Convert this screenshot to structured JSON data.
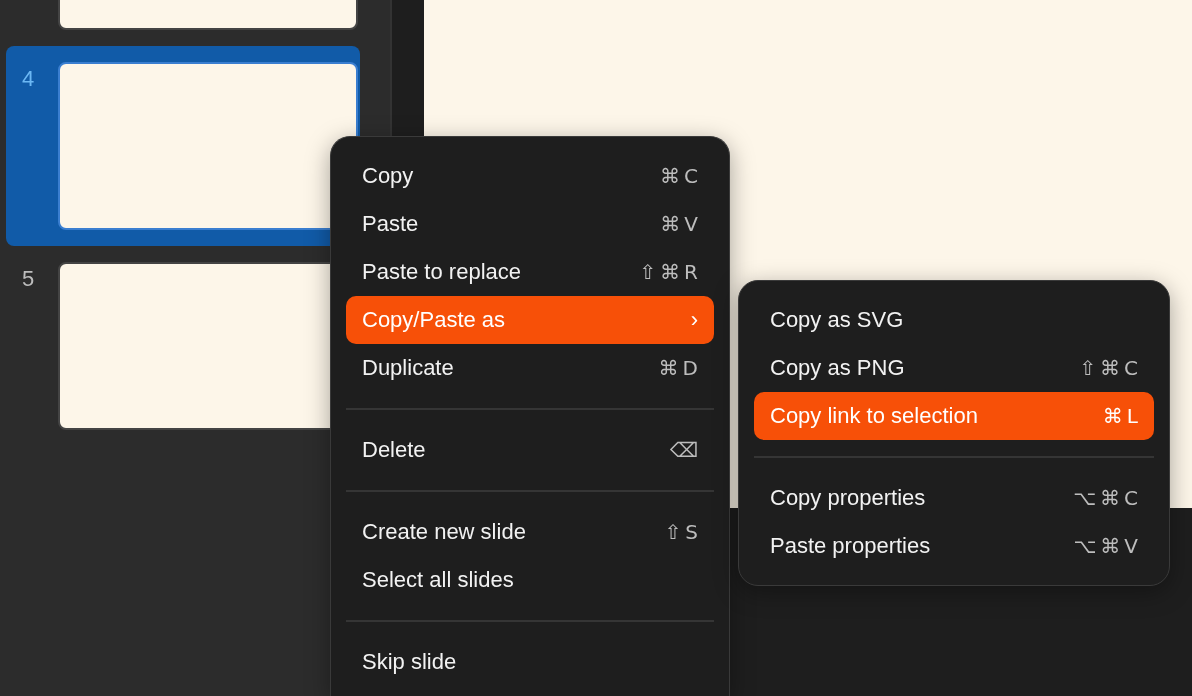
{
  "slides": [
    {
      "selected": false
    },
    {
      "number": "4",
      "selected": true
    },
    {
      "number": "5",
      "selected": false
    }
  ],
  "context_menu": {
    "items": [
      {
        "kind": "item",
        "label": "Copy",
        "shortcut": "⌘C",
        "selected": false
      },
      {
        "kind": "item",
        "label": "Paste",
        "shortcut": "⌘V",
        "selected": false
      },
      {
        "kind": "item",
        "label": "Paste to replace",
        "shortcut": "⇧⌘R",
        "selected": false
      },
      {
        "kind": "submenu",
        "label": "Copy/Paste as",
        "arrow": "›",
        "selected": true
      },
      {
        "kind": "item",
        "label": "Duplicate",
        "shortcut": "⌘D",
        "selected": false
      },
      {
        "kind": "separator"
      },
      {
        "kind": "item",
        "label": "Delete",
        "shortcut": "⌫",
        "selected": false
      },
      {
        "kind": "separator"
      },
      {
        "kind": "item",
        "label": "Create new slide",
        "shortcut": "⇧S",
        "selected": false
      },
      {
        "kind": "item",
        "label": "Select all slides",
        "selected": false
      },
      {
        "kind": "separator"
      },
      {
        "kind": "item",
        "label": "Skip slide",
        "selected": false
      }
    ]
  },
  "submenu": {
    "items": [
      {
        "kind": "item",
        "label": "Copy as SVG",
        "selected": false
      },
      {
        "kind": "item",
        "label": "Copy as PNG",
        "shortcut": "⇧⌘C",
        "selected": false
      },
      {
        "kind": "item",
        "label": "Copy link to selection",
        "shortcut": "⌘L",
        "selected": true
      },
      {
        "kind": "separator"
      },
      {
        "kind": "item",
        "label": "Copy properties",
        "shortcut": "⌥⌘C",
        "selected": false
      },
      {
        "kind": "item",
        "label": "Paste properties",
        "shortcut": "⌥⌘V",
        "selected": false
      }
    ]
  }
}
